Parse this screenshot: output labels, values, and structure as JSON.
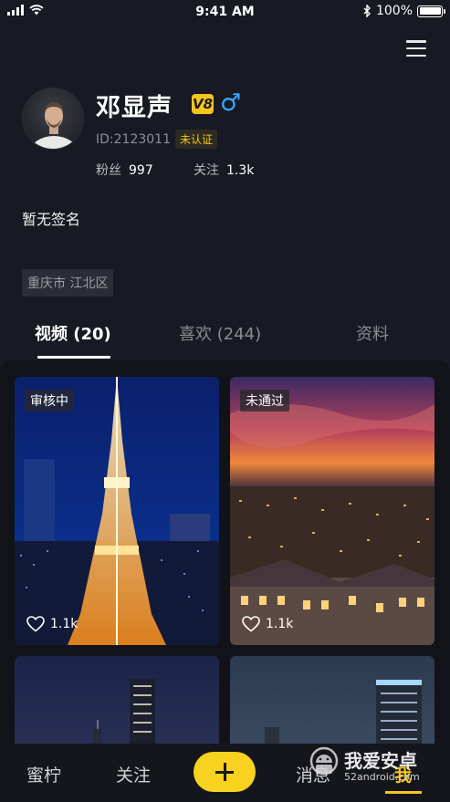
{
  "status_bar": {
    "time": "9:41 AM",
    "battery": "100%",
    "battery_level": 1.0
  },
  "profile": {
    "name": "邓显声",
    "vip_badge": "V8",
    "gender_symbol": "♂",
    "user_id": "ID:2123011",
    "verify_status": "未认证",
    "fans_label": "粉丝",
    "fans_count": "997",
    "following_label": "关注",
    "following_count": "1.3k",
    "signature": "暂无签名",
    "location": "重庆市 江北区"
  },
  "tabs": [
    {
      "label": "视频 (20)",
      "active": true
    },
    {
      "label": "喜欢 (244)",
      "active": false
    },
    {
      "label": "资料",
      "active": false
    }
  ],
  "videos": [
    {
      "status": "审核中",
      "likes": "1.1k",
      "scene": "tokyo-tower-night"
    },
    {
      "status": "未通过",
      "likes": "1.1k",
      "scene": "city-sunset"
    },
    {
      "scene": "city-night-skyline"
    },
    {
      "scene": "skyscraper-dusk"
    }
  ],
  "bottom_nav": {
    "items": [
      "蜜柠",
      "关注",
      "消息",
      "我"
    ],
    "active": "我"
  },
  "watermark": {
    "title": "我爱安卓",
    "subtitle": "52android.com"
  },
  "colors": {
    "accent": "#f7d21e",
    "gender_male": "#3aa7ff",
    "background": "#171a22"
  }
}
